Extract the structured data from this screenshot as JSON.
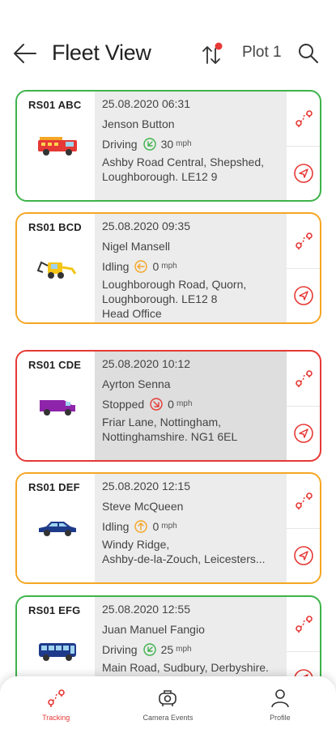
{
  "header": {
    "title": "Fleet View",
    "plot_label": "Plot 1",
    "back_icon": "arrow-left-icon",
    "sort_icon": "sort-icon",
    "search_icon": "search-icon"
  },
  "colors": {
    "accent": "#e53935",
    "driving": "#3db34a",
    "idling": "#f5a623",
    "stopped": "#e53935"
  },
  "vehicles": [
    {
      "reg": "RS01 ABC",
      "datetime": "25.08.2020  06:31",
      "driver": "Jenson Button",
      "status": "Driving",
      "speed": "30",
      "speed_unit": "mph",
      "address": "Ashby Road Central, Shepshed,\nLoughborough. LE12 9",
      "vehicle_icon": "fire-engine-icon",
      "status_color": "green"
    },
    {
      "reg": "RS01 BCD",
      "datetime": "25.08.2020  09:35",
      "driver": "Nigel Mansell",
      "status": "Idling",
      "speed": "0",
      "speed_unit": "mph",
      "address": "Loughborough Road, Quorn,\nLoughborough. LE12 8\nHead Office",
      "vehicle_icon": "excavator-icon",
      "status_color": "orange"
    },
    {
      "reg": "RS01 CDE",
      "datetime": "25.08.2020  10:12",
      "driver": "Ayrton Senna",
      "status": "Stopped",
      "speed": "0",
      "speed_unit": "mph",
      "address": "Friar Lane, Nottingham,\nNottinghamshire. NG1 6EL",
      "vehicle_icon": "van-icon",
      "status_color": "red"
    },
    {
      "reg": "RS01 DEF",
      "datetime": "25.08.2020  12:15",
      "driver": "Steve McQueen",
      "status": "Idling",
      "speed": "0",
      "speed_unit": "mph",
      "address": "Windy Ridge,\nAshby-de-la-Zouch, Leicesters...",
      "vehicle_icon": "car-icon",
      "status_color": "orange"
    },
    {
      "reg": "RS01 EFG",
      "datetime": "25.08.2020  12:55",
      "driver": "Juan Manuel Fangio",
      "status": "Driving",
      "speed": "25",
      "speed_unit": "mph",
      "address": "Main Road, Sudbury, Derbyshire.",
      "vehicle_icon": "bus-icon",
      "status_color": "green"
    }
  ],
  "tabbar": {
    "tabs": [
      {
        "label": "Tracking",
        "icon": "tracking-icon",
        "active": true
      },
      {
        "label": "Camera Events",
        "icon": "camera-icon",
        "active": false
      },
      {
        "label": "Profile",
        "icon": "profile-icon",
        "active": false
      }
    ]
  }
}
